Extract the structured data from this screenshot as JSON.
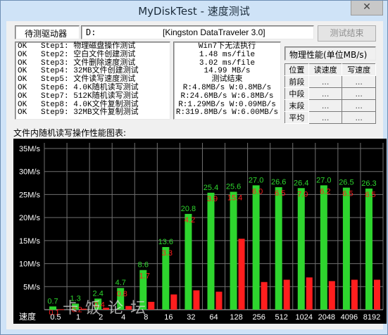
{
  "window": {
    "title": "MyDiskTest - 速度测试",
    "close": "✕"
  },
  "top": {
    "drive_label": "待测驱动器",
    "drive_letter": "D:",
    "drive_name": "[Kingston DataTraveler 3.0]",
    "finish_button": "测试结束"
  },
  "steps": [
    "OK   Step1: 物理磁盘操作测试",
    "OK   Step2: 空白文件创建测试",
    "OK   Step3: 文件删除速度测试",
    "OK   Step4: 32MB文件创建测试",
    "OK   Step5: 文件读写速度测试",
    "OK   Step6: 4.0K随机读写测试",
    "OK   Step7: 512K随机读写测试",
    "OK   Step8: 4.0K文件复制测试",
    "OK   Step9: 32MB文件复制测试"
  ],
  "results": [
    "Win7下无法执行",
    "1.48 ms/file",
    "3.02 ms/file",
    "14.99 MB/s",
    "测试结束",
    "R:4.8MB/s W:0.8MB/s",
    "R:24.6MB/s W:6.8MB/s",
    "R:1.29MB/s W:0.09MB/s",
    "R:319.8MB/s W:6.00MB/s"
  ],
  "perf": {
    "title": "物理性能(单位MB/s)",
    "headers": [
      "位置",
      "读速度",
      "写速度"
    ],
    "rows": [
      {
        "label": "前段",
        "read": "...",
        "write": "..."
      },
      {
        "label": "中段",
        "read": "...",
        "write": "..."
      },
      {
        "label": "末段",
        "read": "...",
        "write": "..."
      },
      {
        "label": "平均",
        "read": "...",
        "write": "..."
      }
    ]
  },
  "chart_label": "文件内随机读写操作性能图表:",
  "watermark": "卡饭论坛",
  "colors": {
    "read": "#2ed52e",
    "write": "#ff1e1e",
    "background": "#000000",
    "grid": "#707070"
  },
  "chart_data": {
    "type": "bar",
    "xlabel": "速度",
    "categories": [
      "0.5",
      "1",
      "2",
      "4",
      "8",
      "16",
      "32",
      "64",
      "128",
      "256",
      "512",
      "1024",
      "2048",
      "4096",
      "8192"
    ],
    "ylim": [
      0,
      35
    ],
    "yticks": [
      "5M/s",
      "10M/s",
      "15M/s",
      "20M/s",
      "25M/s",
      "30M/s",
      "35M/s"
    ],
    "series": [
      {
        "values": [
          0.7,
          1.3,
          2.4,
          4.7,
          8.6,
          13.6,
          20.8,
          25.4,
          25.6,
          27.0,
          26.6,
          26.4,
          27.0,
          26.5,
          26.3
        ],
        "labels": [
          "0.7",
          "1.3",
          "2.4",
          "4.7",
          "8.6",
          "13.6",
          "20.8",
          "25.4",
          "25.6",
          "27.0",
          "26.6",
          "26.4",
          "27.0",
          "26.5",
          "26.3"
        ]
      },
      {
        "values": [
          0.1,
          0.2,
          0.4,
          0.8,
          1.7,
          3.3,
          4.2,
          3.9,
          15.4,
          6.0,
          6.5,
          7.0,
          6.2,
          6.5,
          6.5
        ],
        "labels": [
          "0.1",
          "0.2",
          "0.4",
          "0.8",
          "1.7",
          "3.3",
          "4.2",
          "3.9",
          "15.4",
          "6.0",
          "6.5",
          "7.0",
          "6.2",
          "6.5",
          "6.5"
        ]
      }
    ]
  }
}
